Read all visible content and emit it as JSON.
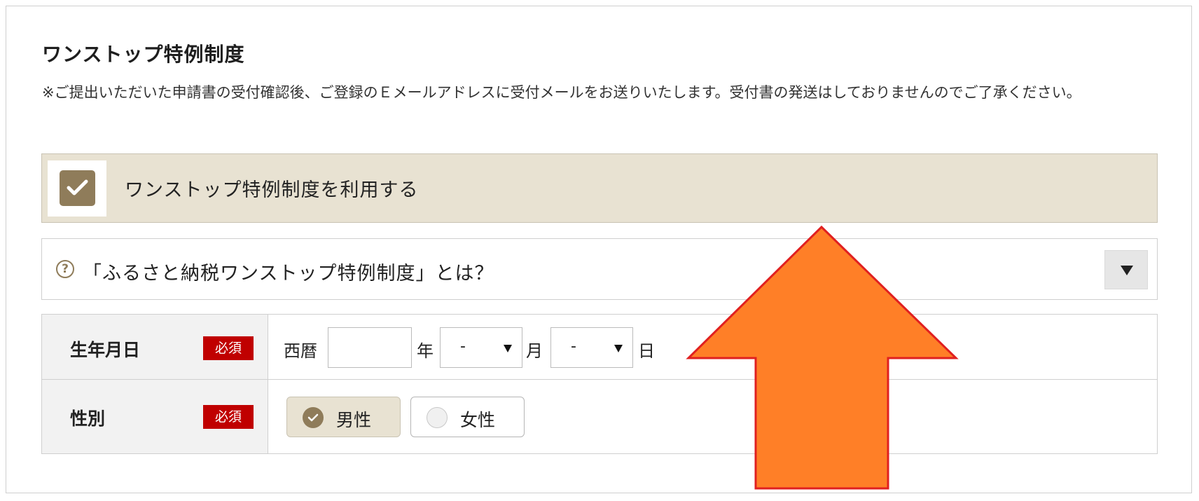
{
  "section": {
    "title": "ワンストップ特例制度",
    "note": "※ご提出いただいた申請書の受付確認後、ご登録のＥメールアドレスに受付メールをお送りいたします。受付書の発送はしておりませんのでご了承ください。"
  },
  "use_checkbox": {
    "label": "ワンストップ特例制度を利用する",
    "checked": true
  },
  "about": {
    "label": "「ふるさと納税ワンストップ特例制度」とは？"
  },
  "form": {
    "birthdate": {
      "label": "生年月日",
      "required": "必須",
      "era": "西暦",
      "year_value": "",
      "year_unit": "年",
      "month_value": "-",
      "month_unit": "月",
      "day_value": "-",
      "day_unit": "日"
    },
    "gender": {
      "label": "性別",
      "required": "必須",
      "options": [
        "男性",
        "女性"
      ],
      "selected": "男性"
    }
  },
  "colors": {
    "accent": "#8f7c5a",
    "selected_bg": "#e8e2d2",
    "required_badge": "#c00000",
    "annotation_arrow_fill": "#ff7f27",
    "annotation_arrow_stroke": "#e02020"
  },
  "annotation": {
    "icon": "up-arrow-annotation"
  }
}
